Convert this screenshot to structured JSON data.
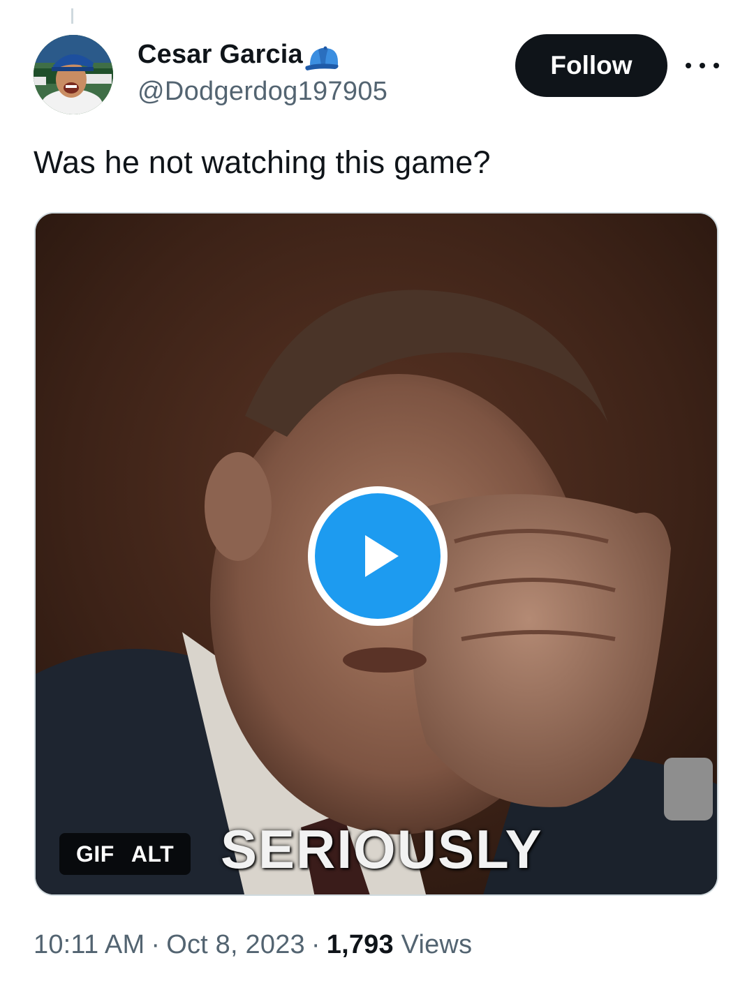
{
  "author": {
    "display_name": "Cesar Garcia",
    "handle": "@Dodgerdog197905",
    "badge_icon": "baseball-cap-icon",
    "badge_color": "#2f7fd6"
  },
  "actions": {
    "follow_label": "Follow",
    "more_icon": "more-dots-icon"
  },
  "tweet": {
    "text": "Was he not watching this game?"
  },
  "media": {
    "type": "GIF",
    "gif_label": "GIF",
    "alt_label": "ALT",
    "caption": "SERIOUSLY",
    "play_icon": "play-icon",
    "play_color": "#1d9bf0"
  },
  "meta": {
    "time": "10:11 AM",
    "separator": "·",
    "date": "Oct 8, 2023",
    "views_count": "1,793",
    "views_label": "Views"
  },
  "colors": {
    "primary_text": "#0f1419",
    "secondary_text": "#536471",
    "border": "#cfd9de"
  }
}
